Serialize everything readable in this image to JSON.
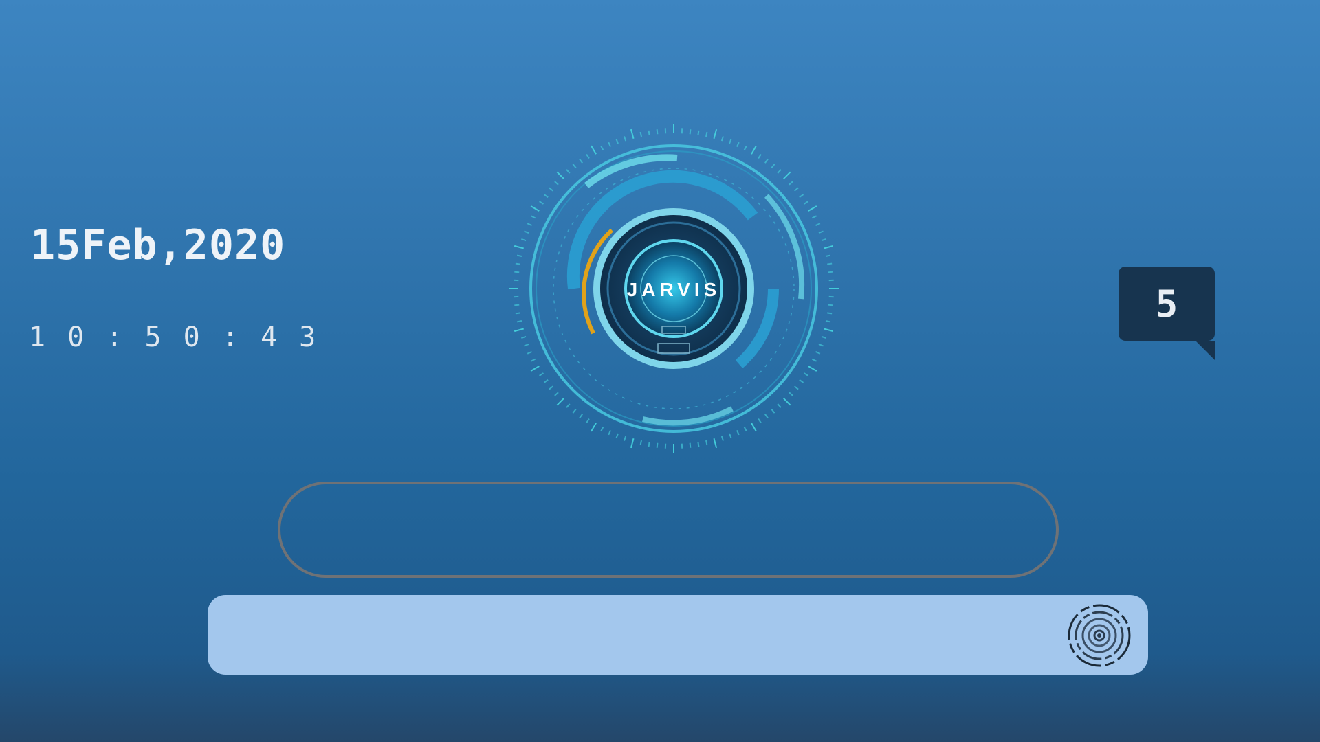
{
  "clock": {
    "date": "15Feb,2020",
    "time": "1 0 : 5 0 : 4 3"
  },
  "assistant": {
    "name": "JARVIS"
  },
  "badge": {
    "count": "5"
  },
  "output": {
    "text": ""
  },
  "input": {
    "value": "",
    "placeholder": ""
  },
  "icons": {
    "hud": "jarvis-hud-icon",
    "mic": "voice-activation-icon"
  },
  "colors": {
    "accent": "#4fd1e8",
    "warning": "#e0a21a",
    "badge_bg": "#17344f",
    "input_bg": "#a3c7ed"
  }
}
